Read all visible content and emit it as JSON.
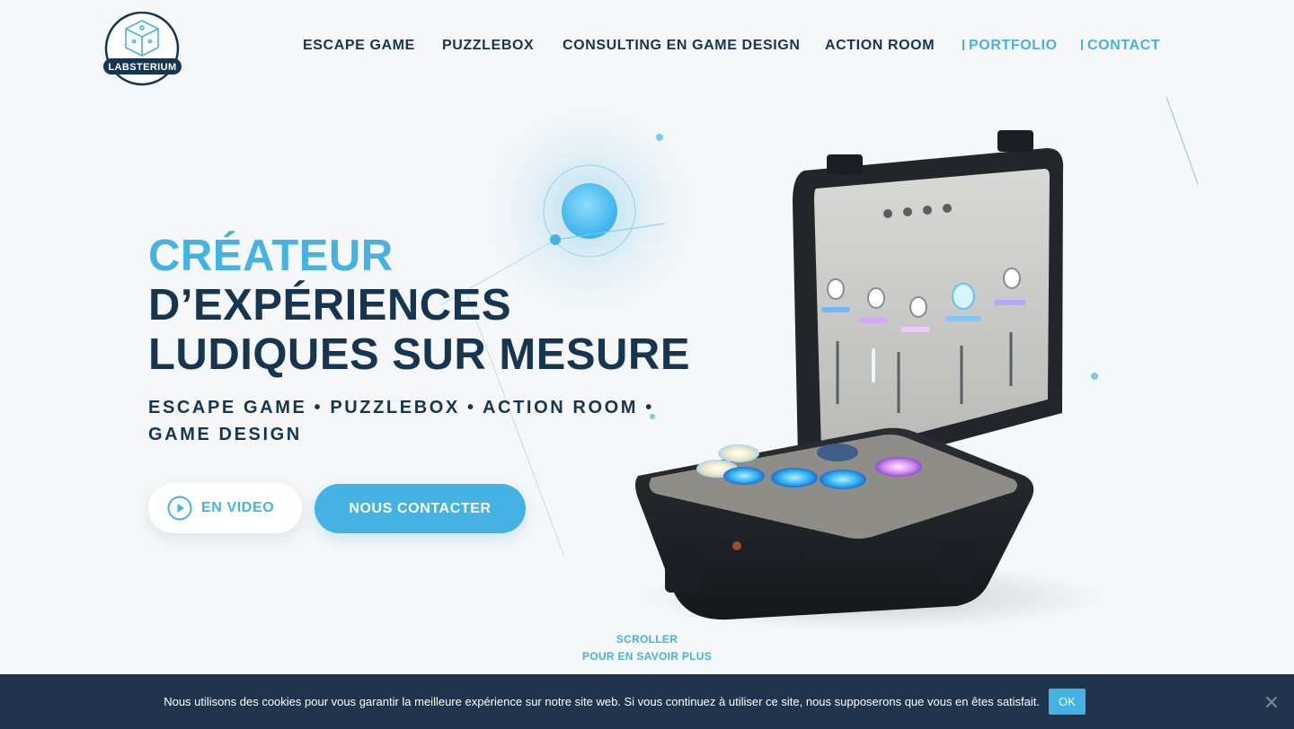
{
  "logo": {
    "text": "LABSTERIUM"
  },
  "nav": {
    "escape_game": "ESCAPE GAME",
    "puzzlebox": "PUZZLEBOX",
    "consulting": "CONSULTING EN GAME DESIGN",
    "action_room": "ACTION ROOM",
    "portfolio": "PORTFOLIO",
    "contact": "CONTACT"
  },
  "hero": {
    "title_line1": "CRÉATEUR",
    "title_line2": "D’EXPÉRIENCES",
    "title_line3": "LUDIQUES SUR MESURE",
    "subtitle": "ESCAPE GAME • PUZZLEBOX • ACTION ROOM • GAME DESIGN",
    "video_button": "EN VIDEO",
    "contact_button": "NOUS CONTACTER"
  },
  "scroll": {
    "line1": "SCROLLER",
    "line2": "POUR EN SAVOIR PLUS"
  },
  "cookie": {
    "message": "Nous utilisons des cookies pour vous garantir la meilleure expérience sur notre site web. Si vous continuez à utiliser ce site, nous supposerons que vous en êtes satisfait.",
    "ok_label": "OK"
  },
  "colors": {
    "accent": "#44b2e2",
    "navy": "#163550",
    "background": "#f6f7f8",
    "cookie_bar": "#20354d"
  },
  "icons": {
    "play": "play-circle-icon",
    "close": "close-icon"
  }
}
